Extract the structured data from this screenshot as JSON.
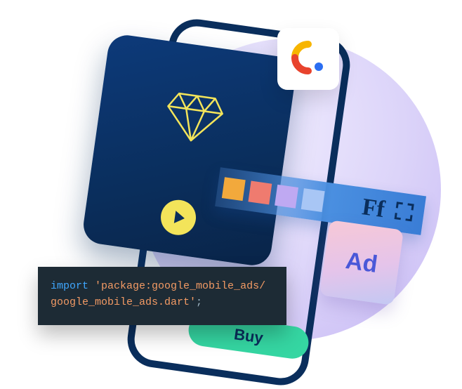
{
  "toolbar": {
    "font_label": "Ff",
    "swatches": [
      "#f2a93c",
      "#ef7b6f",
      "#bfa9f2",
      "#a8c6f5"
    ]
  },
  "ad_tile": {
    "label": "Ad"
  },
  "buy_button": {
    "label": "Buy"
  },
  "code": {
    "keyword": "import",
    "string_open": "'package:google_mobile_ads/",
    "string_close": "google_mobile_ads.dart'",
    "terminator": ";"
  }
}
